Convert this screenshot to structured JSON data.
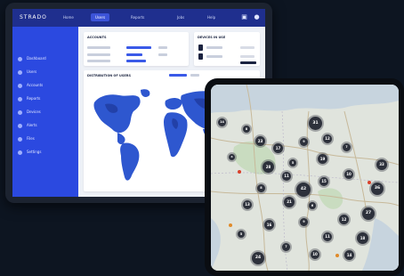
{
  "app": {
    "logo": "STRADO",
    "nav": [
      {
        "label": "Home",
        "active": false
      },
      {
        "label": "Users",
        "active": true
      },
      {
        "label": "Reports",
        "active": false
      },
      {
        "label": "Jobs",
        "active": false
      },
      {
        "label": "Help",
        "active": false
      }
    ],
    "top_icons": [
      "chat-icon",
      "user-icon"
    ]
  },
  "sidebar": {
    "heading": "",
    "items": [
      {
        "label": "Dashboard",
        "icon": "dashboard-icon"
      },
      {
        "label": "Users",
        "icon": "users-icon"
      },
      {
        "label": "Accounts",
        "icon": "accounts-icon"
      },
      {
        "label": "Reports",
        "icon": "reports-icon"
      },
      {
        "label": "Devices",
        "icon": "devices-icon"
      },
      {
        "label": "Alerts",
        "icon": "alerts-icon"
      },
      {
        "label": "Files",
        "icon": "files-icon"
      },
      {
        "label": "Settings",
        "icon": "settings-icon"
      }
    ]
  },
  "cards": {
    "left_title": "ACCOUNTS",
    "right_title": "DEVICES IN USE",
    "map_title": "DISTRIBUTION OF USERS"
  },
  "map": {
    "clusters": [
      {
        "label": "14"
      },
      {
        "label": "8"
      },
      {
        "label": "23"
      },
      {
        "label": "6"
      },
      {
        "label": "31"
      },
      {
        "label": "12"
      },
      {
        "label": "9"
      },
      {
        "label": "17"
      },
      {
        "label": "5"
      },
      {
        "label": "28"
      },
      {
        "label": "11"
      },
      {
        "label": "7"
      },
      {
        "label": "19"
      },
      {
        "label": "42"
      },
      {
        "label": "15"
      },
      {
        "label": "10"
      },
      {
        "label": "36"
      },
      {
        "label": "8"
      },
      {
        "label": "13"
      },
      {
        "label": "21"
      },
      {
        "label": "6"
      },
      {
        "label": "9"
      },
      {
        "label": "12"
      },
      {
        "label": "27"
      },
      {
        "label": "16"
      },
      {
        "label": "5"
      },
      {
        "label": "11"
      },
      {
        "label": "18"
      },
      {
        "label": "7"
      },
      {
        "label": "24"
      },
      {
        "label": "10"
      },
      {
        "label": "33"
      },
      {
        "label": "14"
      }
    ]
  },
  "colors": {
    "brand": "#2b49e0",
    "topbar": "#1f2f8e",
    "map_land": "#2e57cf",
    "cluster": "#2d313b"
  }
}
